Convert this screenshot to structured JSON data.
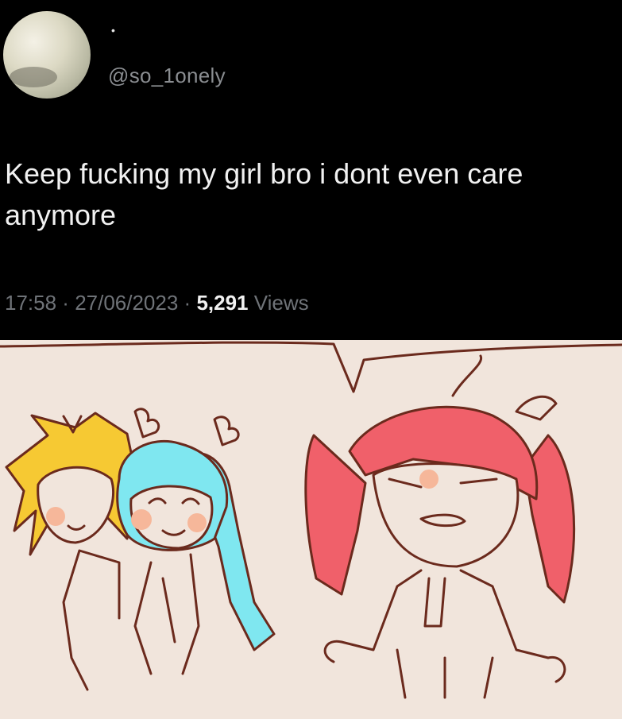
{
  "tweet": {
    "display_name": "•",
    "handle": "@so_1onely",
    "text": "Keep fucking my girl bro i dont even care anymore",
    "time": "17:58",
    "date": "27/06/2023",
    "views_count": "5,291",
    "views_label": "Views",
    "separator": " · "
  },
  "comic": {
    "description_icon": "speech-bubble-icon",
    "colors": {
      "background": "#f1e5dc",
      "outline": "#6b2a1d",
      "red_hair": "#f0606a",
      "blue_hair": "#7fe7f0",
      "yellow_hair": "#f6c933",
      "blush": "#f6b79a"
    }
  }
}
